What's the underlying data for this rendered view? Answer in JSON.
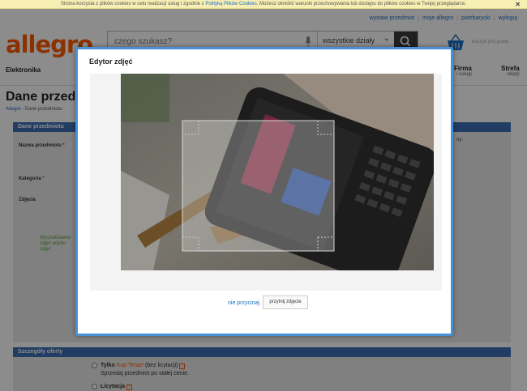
{
  "cookie_bar": {
    "text_before": "Strona korzysta z plików cookies w celu realizacji usług i zgodnie z",
    "link": "Polityką Plików Cookies",
    "text_after": ". Możesz określić warunki przechowywania lub dostępu do plików cookies w Twojej przeglądarce.",
    "close": "✕"
  },
  "top_links": {
    "sell": "wystaw przedmiot",
    "my_allegro": "moje allegro",
    "user": "piotrbarycki",
    "logout": "wyloguj"
  },
  "logo": "allegro",
  "search": {
    "placeholder": "czego szukasz?",
    "category": "wszystkie działy",
    "category_arrow": "⌄"
  },
  "cart": {
    "label": "koszyk jest pusty"
  },
  "nav": {
    "left": "Elektronika",
    "firma": "Firma",
    "firma_sub": "i usługi",
    "strefa": "Strefa",
    "strefa_sub": "okazji"
  },
  "page": {
    "title": "Dane przedm",
    "breadcrumb_home": "Allegro",
    "breadcrumb_current": "- Dane przedmiotu"
  },
  "section_item": {
    "header": "Dane przedmiotu",
    "name_label": "Nazwa przedmiotu",
    "category_label": "Kategoria",
    "photos_label": "Zdjęcia",
    "right_fragment": "ny:",
    "handwritten": "Wyszukiwarka zdjęć edytor zdjęć"
  },
  "section_offer": {
    "header": "Szczegóły oferty",
    "opt1_bold": "Tylko",
    "opt1_accent": "Kup Teraz!",
    "opt1_rest": "(bez licytacji)",
    "opt1_desc": "Sprzedaj przedmiot po stałej cenie.",
    "opt2_bold": "Licytacja",
    "info_icon": "i"
  },
  "modal": {
    "title": "Edytor zdjęć",
    "no_crop_link": "nie przycinaj",
    "crop_button": "przytnij zdjęcie"
  },
  "colors": {
    "brand": "#ff5a00",
    "link": "#1a6fc4",
    "section_bar": "#3d6fb5",
    "modal_border": "#4a90d6"
  }
}
